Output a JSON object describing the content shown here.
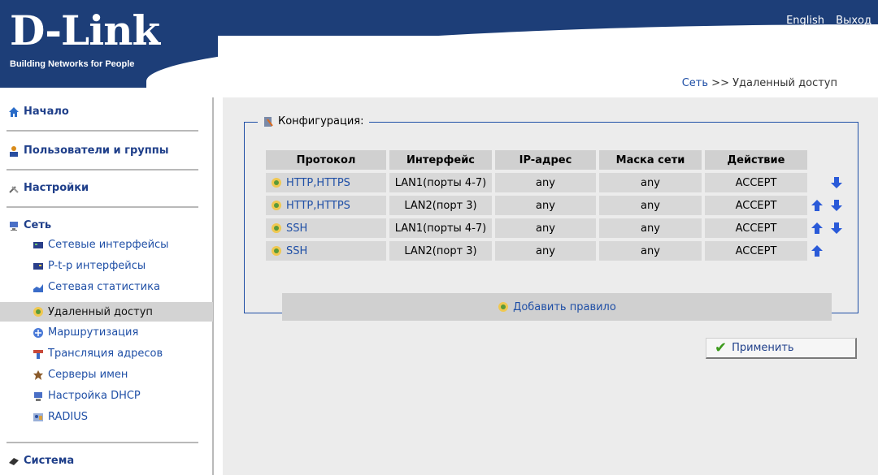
{
  "header": {
    "logo": "D-Link",
    "tagline": "Building Networks for People",
    "links": [
      "English",
      "Выход"
    ]
  },
  "breadcrumb": {
    "section": "Сеть",
    "separator": ">>",
    "page": "Удаленный доступ"
  },
  "sidebar": {
    "sections": [
      {
        "label": "Начало",
        "icon": "home-icon"
      },
      {
        "label": "Пользователи и группы",
        "icon": "users-icon"
      },
      {
        "label": "Настройки",
        "icon": "tools-icon"
      },
      {
        "label": "Сеть",
        "icon": "computer-icon"
      },
      {
        "label": "Система",
        "icon": "system-icon"
      }
    ],
    "network_items": [
      {
        "label": "Сетевые интерфейсы",
        "icon": "network-card-icon"
      },
      {
        "label": "P-t-p интерфейсы",
        "icon": "ptp-icon"
      },
      {
        "label": "Сетевая статистика",
        "icon": "chart-icon"
      },
      {
        "label": "Удаленный доступ",
        "icon": "remote-access-icon",
        "active": true
      },
      {
        "label": "Маршрутизация",
        "icon": "routing-icon"
      },
      {
        "label": "Трансляция адресов",
        "icon": "nat-icon"
      },
      {
        "label": "Серверы имен",
        "icon": "dns-icon"
      },
      {
        "label": "Настройка DHCP",
        "icon": "dhcp-icon"
      },
      {
        "label": "RADIUS",
        "icon": "radius-icon"
      }
    ]
  },
  "config": {
    "legend": "Конфигурация:",
    "columns": [
      "Протокол",
      "Интерфейс",
      "IP-адрес",
      "Маска сети",
      "Действие"
    ],
    "rows": [
      {
        "protocol": "HTTP,HTTPS",
        "interface": "LAN1(порты 4-7)",
        "ip": "any",
        "mask": "any",
        "action": "ACCEPT",
        "up": false,
        "down": true
      },
      {
        "protocol": "HTTP,HTTPS",
        "interface": "LAN2(порт 3)",
        "ip": "any",
        "mask": "any",
        "action": "ACCEPT",
        "up": true,
        "down": true
      },
      {
        "protocol": "SSH",
        "interface": "LAN1(порты 4-7)",
        "ip": "any",
        "mask": "any",
        "action": "ACCEPT",
        "up": true,
        "down": true
      },
      {
        "protocol": "SSH",
        "interface": "LAN2(порт 3)",
        "ip": "any",
        "mask": "any",
        "action": "ACCEPT",
        "up": true,
        "down": false
      }
    ],
    "add_rule": "Добавить правило"
  },
  "apply_label": "Применить",
  "colors": {
    "brand": "#1d3e78",
    "link": "#1f4fa6",
    "accept": "#3c9a1c"
  }
}
